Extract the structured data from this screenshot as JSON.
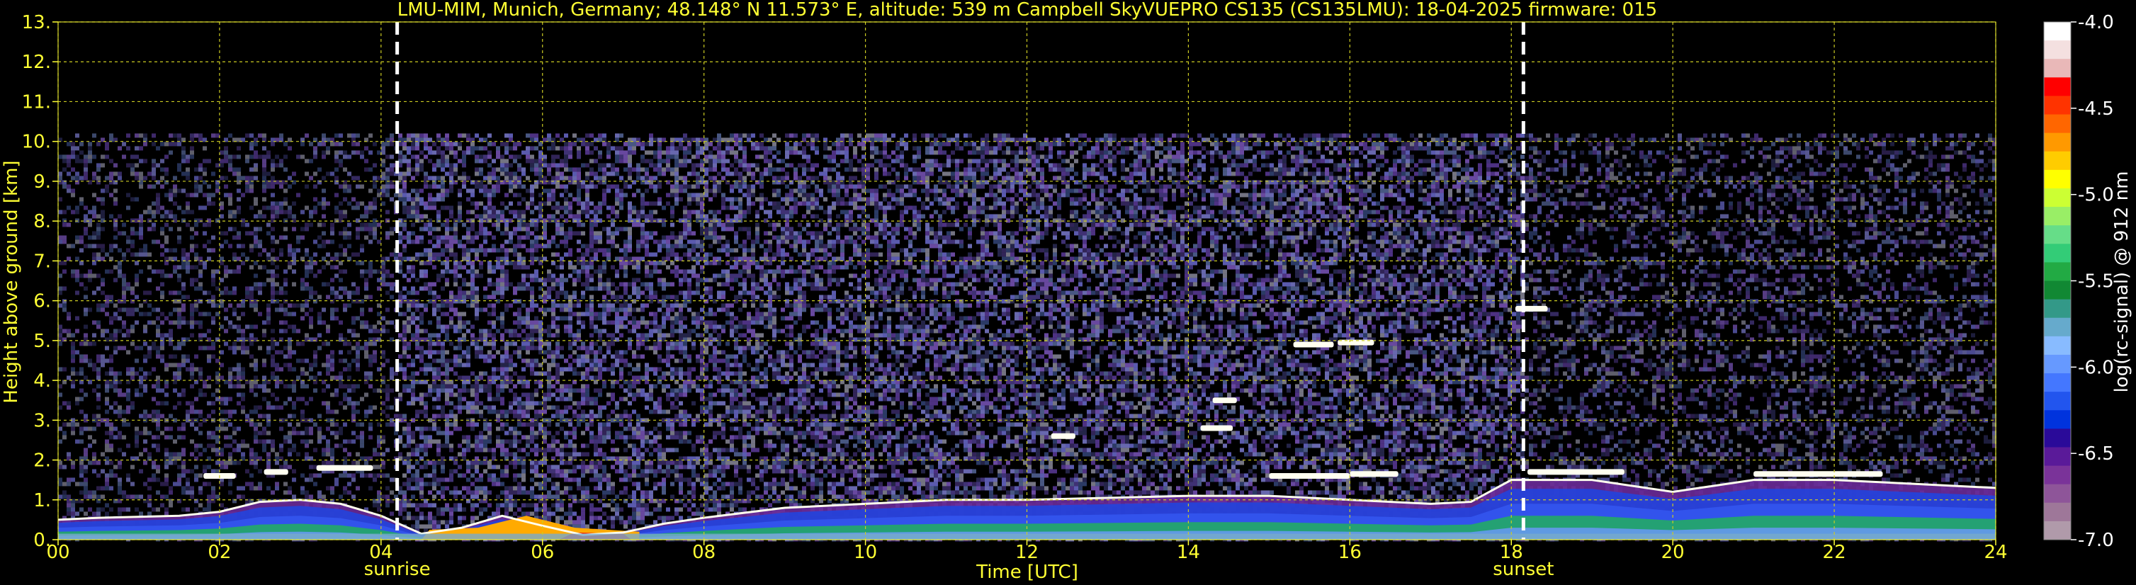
{
  "chart_data": {
    "type": "heatmap",
    "title": "LMU-MIM, Munich, Germany; 48.148° N 11.573° E, altitude: 539 m    Campbell SkyVUEPRO CS135 (CS135LMU): 18-04-2025    firmware: 015",
    "xlabel": "Time [UTC]",
    "ylabel": "Height above ground [km]",
    "xlim": [
      0,
      24
    ],
    "ylim": [
      0,
      13
    ],
    "x_ticks": [
      "00",
      "02",
      "04",
      "06",
      "08",
      "10",
      "12",
      "14",
      "16",
      "18",
      "20",
      "22",
      "24"
    ],
    "y_ticks": [
      "0.",
      "1.",
      "2.",
      "3.",
      "4.",
      "5.",
      "6.",
      "7.",
      "8.",
      "9.",
      "10.",
      "11.",
      "12.",
      "13."
    ],
    "grid": true,
    "markers": [
      {
        "label": "sunrise",
        "x": 4.2
      },
      {
        "label": "sunset",
        "x": 18.15
      }
    ],
    "colorbar": {
      "label": "log(rc-signal) @ 912 nm",
      "range": [
        -7.0,
        -4.0
      ],
      "ticks": [
        "-4.0",
        "-4.5",
        "-5.0",
        "-5.5",
        "-6.0",
        "-6.5",
        "-7.0"
      ],
      "colors": [
        "#ffffff",
        "#f4e0e0",
        "#e9b8b8",
        "#ff0000",
        "#ff3300",
        "#ff6600",
        "#ff9900",
        "#ffcc00",
        "#ffff00",
        "#ccff33",
        "#99ee66",
        "#66dd88",
        "#33cc77",
        "#22aa44",
        "#118833",
        "#339988",
        "#66aacc",
        "#88bbff",
        "#6699ff",
        "#4477ff",
        "#2255ee",
        "#0033dd",
        "#2a0a99",
        "#5a1a99",
        "#7a3399",
        "#8e5599",
        "#9e7799",
        "#b09aaa"
      ]
    },
    "layers": [
      {
        "name": "aerosol",
        "x": [
          0,
          0.5,
          1.5,
          2.0,
          2.5,
          3.0,
          3.5,
          4.0,
          4.5,
          5.0,
          5.5,
          6.0,
          6.5,
          7.0,
          7.5,
          8.0,
          9.0,
          10,
          11,
          12,
          13,
          14,
          15,
          16,
          17,
          17.5,
          18,
          19,
          20,
          21,
          22,
          23,
          24
        ],
        "top_km": [
          0.5,
          0.55,
          0.6,
          0.7,
          0.95,
          1.0,
          0.9,
          0.6,
          0.15,
          0.3,
          0.6,
          0.35,
          0.12,
          0.18,
          0.4,
          0.55,
          0.8,
          0.9,
          1.0,
          1.0,
          1.05,
          1.1,
          1.1,
          1.0,
          0.9,
          0.95,
          1.5,
          1.5,
          1.2,
          1.5,
          1.5,
          1.4,
          1.3
        ]
      },
      {
        "name": "clouds",
        "segments": [
          {
            "x0": 1.8,
            "x1": 2.2,
            "y": 1.6
          },
          {
            "x0": 2.55,
            "x1": 2.85,
            "y": 1.7
          },
          {
            "x0": 3.2,
            "x1": 3.9,
            "y": 1.8
          },
          {
            "x0": 12.3,
            "x1": 12.6,
            "y": 2.6
          },
          {
            "x0": 14.15,
            "x1": 14.55,
            "y": 2.8
          },
          {
            "x0": 14.3,
            "x1": 14.6,
            "y": 3.5
          },
          {
            "x0": 15.3,
            "x1": 15.8,
            "y": 4.9
          },
          {
            "x0": 15.85,
            "x1": 16.3,
            "y": 4.95
          },
          {
            "x0": 18.05,
            "x1": 18.45,
            "y": 5.8
          },
          {
            "x0": 15.0,
            "x1": 16.0,
            "y": 1.6
          },
          {
            "x0": 16.0,
            "x1": 16.6,
            "y": 1.65
          },
          {
            "x0": 18.2,
            "x1": 19.4,
            "y": 1.7
          },
          {
            "x0": 21.0,
            "x1": 22.6,
            "y": 1.65
          }
        ]
      }
    ],
    "noise_top_km": 10.2
  }
}
